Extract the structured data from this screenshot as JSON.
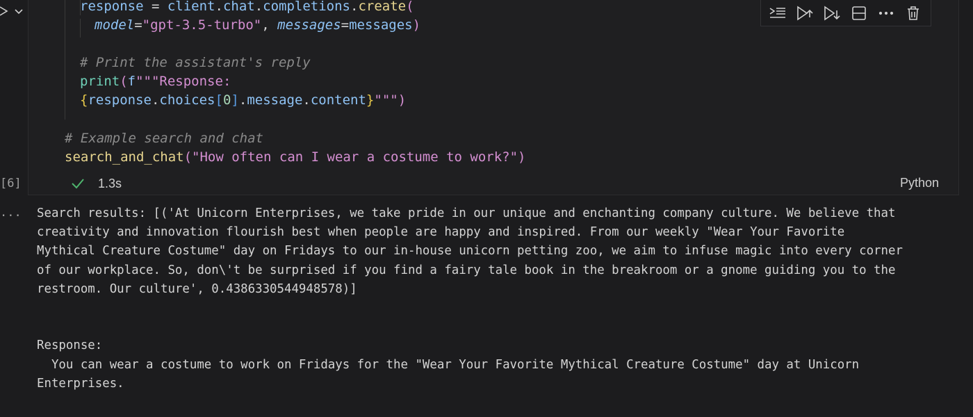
{
  "cell": {
    "execution_count": "[6]",
    "status": "success",
    "duration": "1.3s",
    "language": "Python",
    "code_lines": [
      {
        "segments": [
          {
            "cls": "kw-var",
            "text": "response"
          },
          {
            "cls": "kw-punc",
            "text": " = "
          },
          {
            "cls": "kw-var",
            "text": "client"
          },
          {
            "cls": "kw-punc",
            "text": "."
          },
          {
            "cls": "kw-var",
            "text": "chat"
          },
          {
            "cls": "kw-punc",
            "text": "."
          },
          {
            "cls": "kw-var",
            "text": "completions"
          },
          {
            "cls": "kw-punc",
            "text": "."
          },
          {
            "cls": "kw-fn",
            "text": "create"
          },
          {
            "cls": "kw-brack",
            "text": "("
          }
        ]
      },
      {
        "segments": [
          {
            "cls": "kw-param",
            "text": "model"
          },
          {
            "cls": "kw-punc",
            "text": "="
          },
          {
            "cls": "kw-str",
            "text": "\"gpt-3.5-turbo\""
          },
          {
            "cls": "kw-punc",
            "text": ", "
          },
          {
            "cls": "kw-param",
            "text": "messages"
          },
          {
            "cls": "kw-punc",
            "text": "="
          },
          {
            "cls": "kw-var",
            "text": "messages"
          },
          {
            "cls": "kw-brack",
            "text": ")"
          }
        ]
      },
      {
        "segments": []
      },
      {
        "segments": [
          {
            "cls": "kw-comment",
            "text": "# Print the assistant's reply"
          }
        ]
      },
      {
        "segments": [
          {
            "cls": "kw-green",
            "text": "print"
          },
          {
            "cls": "kw-brack",
            "text": "("
          },
          {
            "cls": "kw-var",
            "text": "f"
          },
          {
            "cls": "kw-str",
            "text": "\"\"\"Response:"
          }
        ]
      },
      {
        "segments": [
          {
            "cls": "kw-brace",
            "text": "{"
          },
          {
            "cls": "kw-var",
            "text": "response"
          },
          {
            "cls": "kw-punc",
            "text": "."
          },
          {
            "cls": "kw-var",
            "text": "choices"
          },
          {
            "cls": "kw-brack2",
            "text": "["
          },
          {
            "cls": "kw-num",
            "text": "0"
          },
          {
            "cls": "kw-brack2",
            "text": "]"
          },
          {
            "cls": "kw-punc",
            "text": "."
          },
          {
            "cls": "kw-var",
            "text": "message"
          },
          {
            "cls": "kw-punc",
            "text": "."
          },
          {
            "cls": "kw-var",
            "text": "content"
          },
          {
            "cls": "kw-brace",
            "text": "}"
          },
          {
            "cls": "kw-str",
            "text": "\"\"\""
          },
          {
            "cls": "kw-brack",
            "text": ")"
          }
        ]
      },
      {
        "segments": []
      },
      {
        "segments": [
          {
            "cls": "kw-comment",
            "text": "# Example search and chat"
          }
        ]
      },
      {
        "segments": [
          {
            "cls": "kw-fn",
            "text": "search_and_chat"
          },
          {
            "cls": "kw-brack",
            "text": "("
          },
          {
            "cls": "kw-str",
            "text": "\"How often can I wear a costume to work?\""
          },
          {
            "cls": "kw-brack",
            "text": ")"
          }
        ]
      }
    ]
  },
  "toolbar": {
    "icons": [
      "run-by-line-icon",
      "execute-above-icon",
      "execute-below-icon",
      "split-cell-icon",
      "more-icon",
      "delete-icon"
    ]
  },
  "output": {
    "more_indicator": "...",
    "lines": [
      "Search results: [('At Unicorn Enterprises, we take pride in our unique and enchanting company culture. We believe that",
      "creativity and innovation flourish best when people are happy and inspired. From our weekly \"Wear Your Favorite",
      "Mythical Creature Costume\" day on Fridays to our in-house unicorn petting zoo, we aim to infuse magic into every corner",
      "of our workplace. So, don\\'t be surprised if you find a fairy tale book in the breakroom or a gnome guiding you to the",
      "restroom. Our culture', 0.4386330544948578)]",
      "",
      "",
      "Response:",
      "  You can wear a costume to work on Fridays for the \"Wear Your Favorite Mythical Creature Costume\" day at Unicorn",
      "Enterprises."
    ]
  }
}
